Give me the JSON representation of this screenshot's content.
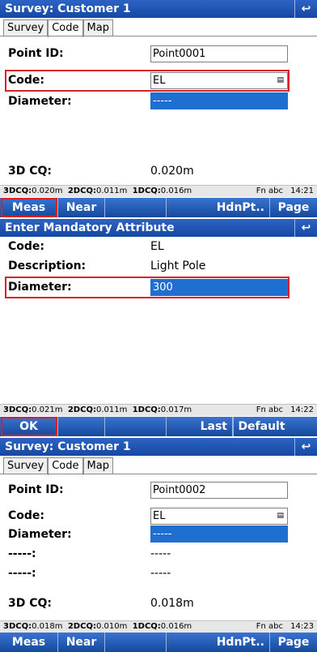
{
  "panel1": {
    "title": "Survey: Customer 1",
    "back_icon": "↩",
    "tabs": [
      "Survey",
      "Code",
      "Map"
    ],
    "point_id_label": "Point ID:",
    "point_id_value": "Point0001",
    "code_label": "Code:",
    "code_value": "EL",
    "diameter_label": "Diameter:",
    "diameter_value": "-----",
    "cq_label": "3D CQ:",
    "cq_value": "0.020m",
    "status": {
      "d3_label": "3DCQ:",
      "d3_value": "0.020m",
      "d2_label": "2DCQ:",
      "d2_value": "0.011m",
      "d1_label": "1DCQ:",
      "d1_value": "0.016m",
      "fn": "Fn abc",
      "time": "14:21"
    },
    "softkeys": [
      "Meas",
      "Near",
      "",
      "HdnPt..",
      "Page"
    ]
  },
  "panel2": {
    "title": "Enter Mandatory Attribute",
    "back_icon": "↩",
    "code_label": "Code:",
    "code_value": "EL",
    "description_label": "Description:",
    "description_value": "Light Pole",
    "diameter_label": "Diameter:",
    "diameter_value": "300",
    "status": {
      "d3_label": "3DCQ:",
      "d3_value": "0.021m",
      "d2_label": "2DCQ:",
      "d2_value": "0.011m",
      "d1_label": "1DCQ:",
      "d1_value": "0.017m",
      "fn": "Fn abc",
      "time": "14:22"
    },
    "softkeys": [
      "OK",
      "",
      "",
      "Last",
      "Default"
    ]
  },
  "panel3": {
    "title": "Survey: Customer 1",
    "back_icon": "↩",
    "tabs": [
      "Survey",
      "Code",
      "Map"
    ],
    "point_id_label": "Point ID:",
    "point_id_value": "Point0002",
    "code_label": "Code:",
    "code_value": "EL",
    "diameter_label": "Diameter:",
    "diameter_value": "-----",
    "extra1_label": "-----:",
    "extra1_value": "-----",
    "extra2_label": "-----:",
    "extra2_value": "-----",
    "cq_label": "3D CQ:",
    "cq_value": "0.018m",
    "status": {
      "d3_label": "3DCQ:",
      "d3_value": "0.018m",
      "d2_label": "2DCQ:",
      "d2_value": "0.010m",
      "d1_label": "1DCQ:",
      "d1_value": "0.016m",
      "fn": "Fn abc",
      "time": "14:23"
    },
    "softkeys": [
      "Meas",
      "Near",
      "",
      "HdnPt..",
      "Page"
    ]
  },
  "colors": {
    "titlebar": "#1f55b4",
    "selected_field": "#1e6fd0",
    "highlight": "#d9202b",
    "statusbar": "#e7e7e7"
  },
  "icons": {
    "back": "return-arrow-icon",
    "dropdown": "dropdown-list-icon"
  }
}
